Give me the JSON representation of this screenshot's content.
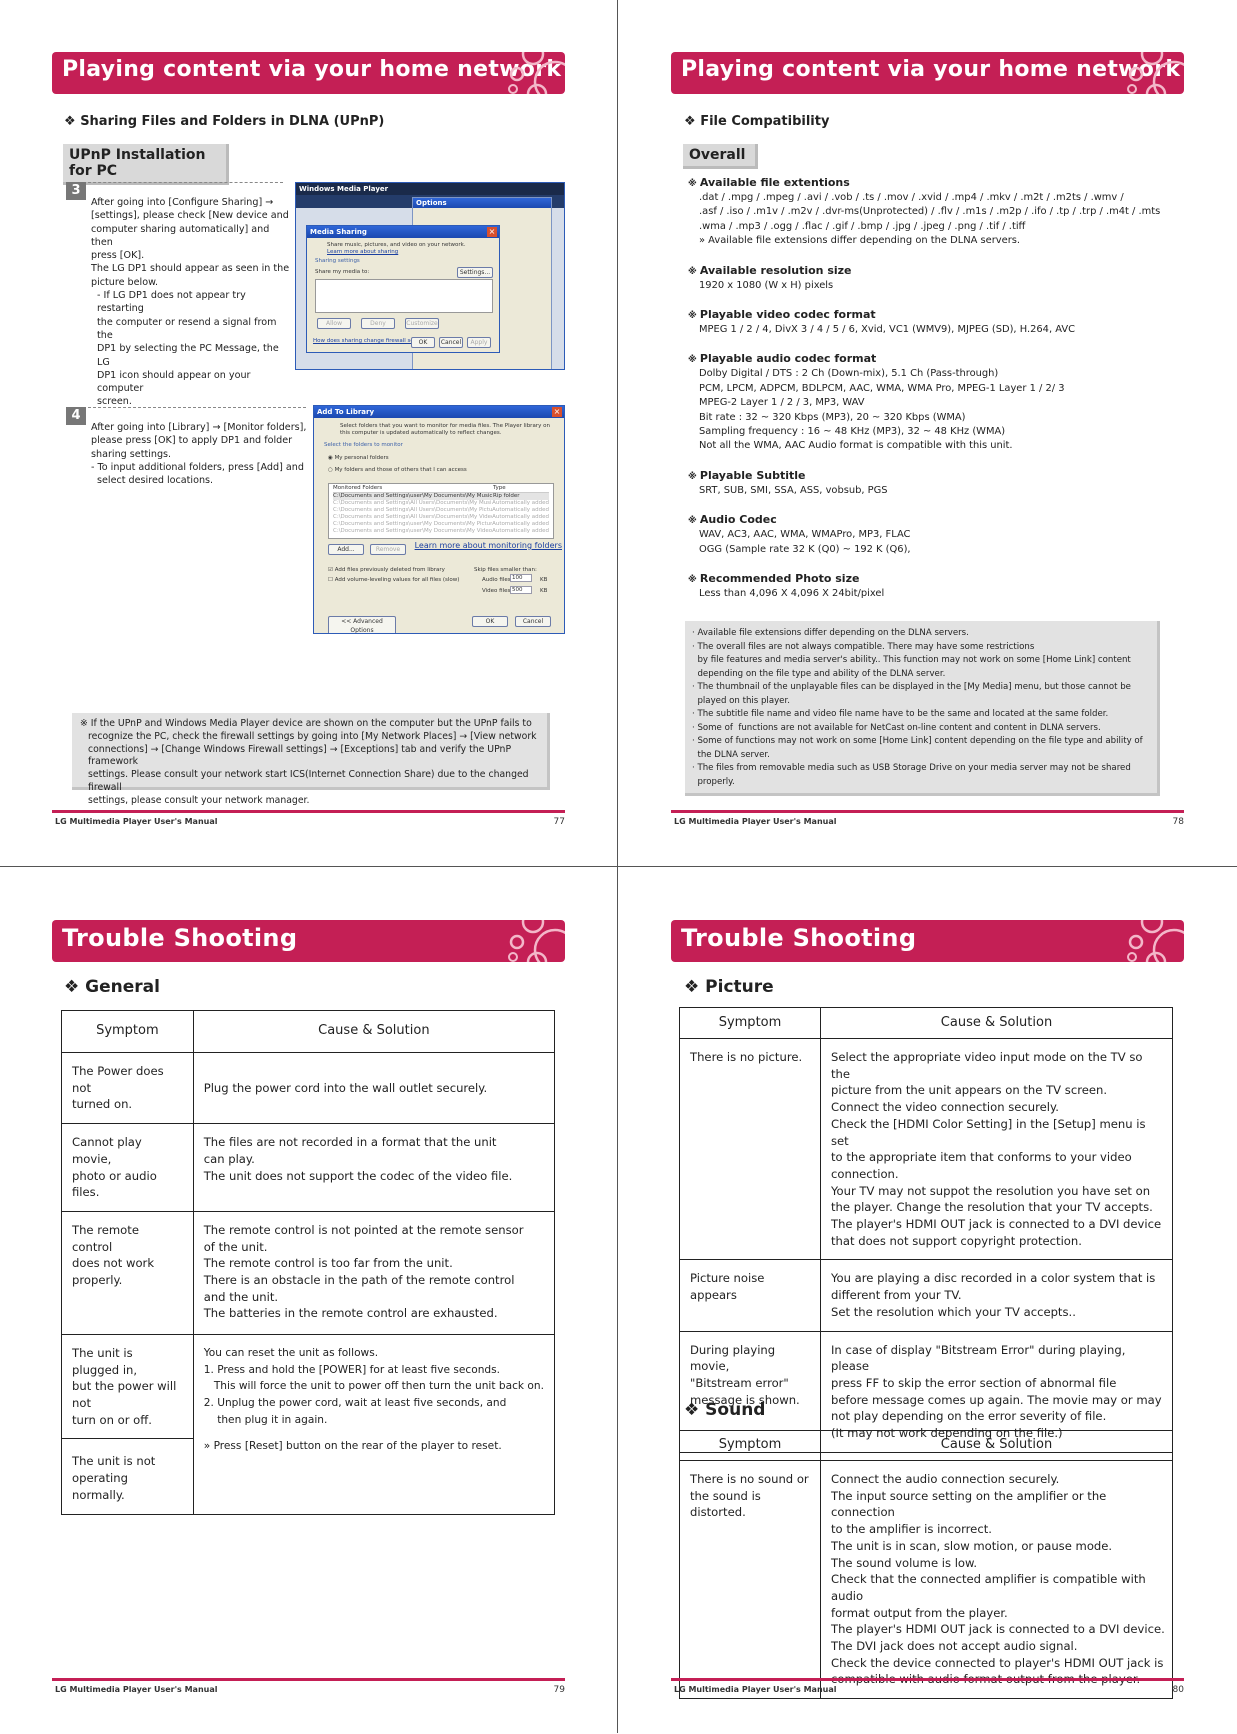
{
  "colors": {
    "accent": "#c41f55",
    "box_gray": "#d9d9d9"
  },
  "footer": "LG Multimedia Player User's Manual",
  "p77": {
    "title": "Playing content via your home network",
    "section": "Sharing Files and Folders in DLNA (UPnP)",
    "box": "UPnP Installation for PC",
    "step3": {
      "num": "3",
      "lines": [
        "After going into [Configure Sharing] →",
        "[settings], please check [New device and",
        "computer sharing automatically] and then",
        "press [OK].",
        "The LG DP1 should appear as seen in the",
        "picture below.",
        "- If LG DP1 does not appear try restarting",
        "the computer or resend a signal from the",
        "DP1 by selecting the PC Message, the LG",
        "DP1 icon should appear on your computer",
        "screen."
      ]
    },
    "shot1": {
      "window_title": "Windows Media Player",
      "options_title": "Options",
      "dialog_title": "Media Sharing",
      "desc": "Share music, pictures, and video on your network.",
      "link": "Learn more about sharing",
      "group": "Sharing settings",
      "check": "Share my media to:",
      "settings_btn": "Settings...",
      "allow": "Allow",
      "deny": "Deny",
      "customize": "Customize",
      "help_link": "How does sharing change firewall settings?",
      "ok": "OK",
      "cancel": "Cancel",
      "apply": "Apply"
    },
    "step4": {
      "num": "4",
      "lines": [
        "After going into [Library] → [Monitor folders],",
        "please press [OK] to apply DP1 and folder",
        "sharing settings.",
        "- To input additional folders, press [Add] and",
        "select desired locations."
      ]
    },
    "shot2": {
      "title": "Add To Library",
      "desc": "Select folders that you want to monitor for media files. The Player library on this computer is updated automatically to reflect changes.",
      "group": "Select the folders to monitor",
      "radio1": "My personal folders",
      "radio2": "My folders and those of others that I can access",
      "col_folder": "Monitored Folders",
      "col_type": "Type",
      "rows": [
        [
          "C:\\Documents and Settings\\user\\My Documents\\My Music",
          "Rip folder"
        ],
        [
          "C:\\Documents and Settings\\All Users\\Documents\\My Music",
          "Automatically added"
        ],
        [
          "C:\\Documents and Settings\\All Users\\Documents\\My Pictures",
          "Automatically added"
        ],
        [
          "C:\\Documents and Settings\\All Users\\Documents\\My Videos",
          "Automatically added"
        ],
        [
          "C:\\Documents and Settings\\user\\My Documents\\My Pictures",
          "Automatically added"
        ],
        [
          "C:\\Documents and Settings\\user\\My Documents\\My Videos",
          "Automatically added"
        ]
      ],
      "add": "Add...",
      "remove": "Remove",
      "learn": "Learn more about monitoring folders",
      "chk1": "Add files previously deleted from library",
      "chk2": "Add volume-leveling values for all files (slow)",
      "skip": "Skip files smaller than:",
      "audio": "Audio files:",
      "audio_val": "100",
      "video": "Video files:",
      "video_val": "500",
      "kb": "KB",
      "advanced": "<< Advanced Options",
      "ok": "OK",
      "cancel": "Cancel"
    },
    "note": [
      "※ If the UPnP and Windows Media Player device are shown on the computer but the UPnP fails to",
      "recognize the PC, check the firewall settings by going into [My Network Places] → [View network",
      "connections] → [Change Windows Firewall settings] → [Exceptions] tab and verify the UPnP framework",
      "settings. Please consult your network start ICS(Internet Connection Share) due to the changed firewall",
      "settings, please consult your network manager."
    ],
    "page": "77"
  },
  "p78": {
    "title": "Playing content via your home network",
    "section": "File Compatibility",
    "box": "Overall",
    "sections": [
      {
        "title": "Available file extentions",
        "lines": [
          ".dat / .mpg / .mpeg / .avi / .vob / .ts / .mov / .xvid / .mp4 / .mkv / .m2t / .m2ts / .wmv /",
          ".asf / .iso / .m1v / .m2v / .dvr-ms(Unprotected) / .flv / .m1s / .m2p / .ifo / .tp / .trp / .m4t / .mts",
          ".wma / .mp3 / .ogg / .flac / .gif / .bmp / .jpg  / .jpeg / .png / .tif / .tiff",
          "» Available file extensions differ depending on the DLNA servers."
        ]
      },
      {
        "title": "Available resolution size",
        "lines": [
          "1920 x 1080 (W x H) pixels"
        ]
      },
      {
        "title": "Playable video codec format",
        "lines": [
          "MPEG 1 / 2 / 4, DivX 3 / 4 / 5 / 6, Xvid, VC1 (WMV9), MJPEG (SD), H.264, AVC"
        ]
      },
      {
        "title": "Playable audio codec format",
        "lines": [
          "Dolby Digital / DTS : 2 Ch (Down-mix), 5.1 Ch (Pass-through)",
          "PCM, LPCM, ADPCM, BDLPCM, AAC, WMA, WMA Pro, MPEG-1 Layer 1 / 2/ 3",
          "MPEG-2 Layer 1 / 2 / 3, MP3, WAV",
          "Bit rate : 32 ~ 320 Kbps (MP3), 20 ~ 320 Kbps (WMA)",
          "Sampling frequency : 16 ~ 48 KHz (MP3), 32 ~ 48 KHz (WMA)",
          "Not all the WMA, AAC Audio format is compatible with this unit."
        ]
      },
      {
        "title": "Playable Subtitle",
        "lines": [
          "SRT, SUB, SMI, SSA, ASS, vobsub, PGS"
        ]
      },
      {
        "title": "Audio Codec",
        "lines": [
          "WAV, AC3, AAC, WMA, WMAPro, MP3, FLAC",
          "OGG (Sample rate 32 K (Q0) ~ 192 K (Q6),"
        ]
      },
      {
        "title": "Recommended Photo size",
        "lines": [
          "Less than 4,096 X 4,096 X 24bit/pixel"
        ]
      }
    ],
    "note": [
      "· Available file extensions differ depending on the DLNA servers.",
      "· The overall files are not always compatible. There may have some restrictions",
      "  by file features and media server's ability.. This function may not work on some [Home Link] content",
      "  depending on the file type and ability of the DLNA server.",
      "· The thumbnail of the unplayable files can be displayed in the [My Media] menu, but those cannot be",
      "  played on this player.",
      "· The subtitle file name and video file name have to be the same and located at the same folder.",
      "· Some of  functions are not available for NetCast on-line content and content in DLNA servers.",
      "· Some of functions may not work on some [Home Link] content depending on the file type and ability of",
      "  the DLNA server.",
      "· The files from removable media such as USB Storage Drive on your media server may not be shared",
      "  properly."
    ],
    "page": "78"
  },
  "p79": {
    "title": "Trouble Shooting",
    "section": "General",
    "col_symptom": "Symptom",
    "col_cause": "Cause & Solution",
    "rows": [
      {
        "symptom": [
          "The Power does not",
          "turned on."
        ],
        "cause": [
          "Plug the power cord into the wall outlet securely."
        ]
      },
      {
        "symptom": [
          "Cannot play movie,",
          "photo or audio files."
        ],
        "cause": [
          "The files are not recorded in a format that the unit",
          "can play.",
          "The unit does not support the codec of the video file."
        ]
      },
      {
        "symptom": [
          "The remote control",
          "does not work properly."
        ],
        "cause": [
          "The remote control is not pointed at the remote sensor",
          "of the unit.",
          "The remote control is too far from the unit.",
          "There is an obstacle in the path of the remote control",
          "and the unit.",
          "The batteries in the remote control are exhausted."
        ]
      }
    ],
    "reset_symptoms": [
      [
        "The unit is plugged in,",
        "but the power will not",
        "turn on or off."
      ],
      [
        "The unit is not operating",
        "normally."
      ]
    ],
    "reset_cause": [
      "You can reset the unit as follows.",
      "1. Press and hold the [POWER] for at least five seconds.",
      "   This will force the unit to power off then turn the unit back on.",
      "2. Unplug the power cord, wait at least five seconds, and",
      "    then plug it in again.",
      "",
      "» Press [Reset] button on the rear of the player to reset."
    ],
    "page": "79"
  },
  "p80": {
    "title": "Trouble Shooting",
    "picture_section": "Picture",
    "sound_section": "Sound",
    "col_symptom": "Symptom",
    "col_cause": "Cause & Solution",
    "picture_rows": [
      {
        "symptom": [
          "There is no picture."
        ],
        "cause": [
          "Select the appropriate video input mode on the TV so the",
          "picture from the unit appears on the TV screen.",
          "Connect the video connection securely.",
          "Check the [HDMI Color Setting] in the [Setup] menu is set",
          "to the appropriate item that conforms to your video",
          "connection.",
          "Your TV may not suppot the resolution you have set on",
          "the player. Change the resolution that your TV accepts.",
          "The player's HDMI OUT jack is connected to a DVI device",
          "that does not support copyright protection."
        ]
      },
      {
        "symptom": [
          "Picture noise appears"
        ],
        "cause": [
          "You are playing a disc recorded in a color system that is",
          "different from your TV.",
          "Set the resolution which your TV accepts.."
        ]
      },
      {
        "symptom": [
          "During playing movie,",
          "\"Bitstream error\"",
          "message is shown."
        ],
        "cause": [
          "In case of display \"Bitstream Error\" during playing, please",
          "press FF to skip the error section of abnormal file",
          "before message comes up again. The movie may or may",
          "not play depending on the error severity of file.",
          "(It may not work depending on the file.)"
        ]
      }
    ],
    "sound_rows": [
      {
        "symptom": [
          "There is no sound or",
          "the sound is distorted."
        ],
        "cause": [
          "Connect the audio connection securely.",
          "The input source setting on the amplifier or the connection",
          "to the amplifier is incorrect.",
          "The unit is in scan, slow motion, or pause mode.",
          "The sound volume is low.",
          "Check that the connected amplifier is compatible with audio",
          "format output from the player.",
          "The player's HDMI OUT jack is connected to a DVI device.",
          "The DVI jack does not accept audio signal.",
          "Check the device connected to player's HDMI OUT jack is",
          "compatible with audio format output from the player."
        ]
      }
    ],
    "page": "80"
  }
}
